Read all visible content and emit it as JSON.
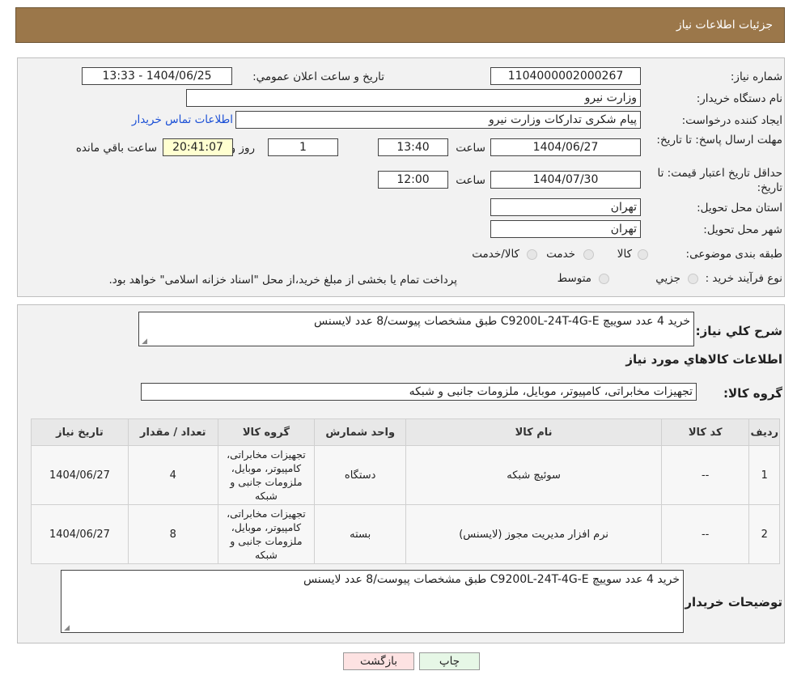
{
  "header": {
    "title": "جزئیات اطلاعات نیاز"
  },
  "info": {
    "need_number_label": "شماره نیاز:",
    "need_number": "1104000002000267",
    "announce_label": "تاریخ و ساعت اعلان عمومي:",
    "announce_value": "1404/06/25 - 13:33",
    "buyer_org_label": "نام دستگاه خريدار:",
    "buyer_org": "وزارت نيرو",
    "creator_label": "ايجاد كننده درخواست:",
    "creator": "پيام شكری تداركات وزارت نيرو",
    "contact_link": "اطلاعات تماس خريدار",
    "deadline_label": "مهلت ارسال پاسخ: تا تاریخ:",
    "deadline_date": "1404/06/27",
    "time_label": "ساعت",
    "deadline_time": "13:40",
    "days": "1",
    "days_label": "روز و",
    "remaining_time": "20:41:07",
    "remaining_label": "ساعت باقي مانده",
    "validity_label": "حداقل تاريخ اعتبار قيمت: تا تاریخ:",
    "validity_date": "1404/07/30",
    "validity_time": "12:00",
    "province_label": "استان محل تحويل:",
    "province": "تهران",
    "city_label": "شهر محل تحويل:",
    "city": "تهران",
    "category_label": "طبقه بندی موضوعی:",
    "category_options": [
      "كالا",
      "خدمت",
      "كالا/خدمت"
    ],
    "process_label": "نوع فرآيند خريد :",
    "process_options": [
      "جزيي",
      "متوسط"
    ],
    "process_note": "پرداخت تمام يا بخشی از مبلغ خريد،از محل \"اسناد خزانه اسلامی\" خواهد بود."
  },
  "details": {
    "summary_label": "شرح كلي نياز:",
    "summary": "خرید 4 عدد سوییچ C9200L-24T-4G-E طبق مشخصات پیوست/8 عدد لایسنس",
    "goods_info_title": "اطلاعات كالاهاي مورد نياز",
    "goods_group_label": "گروه كالا:",
    "goods_group": "تجهيزات مخابراتی، كامپيوتر، موبايل، ملزومات جانبی و شبكه",
    "table": {
      "headers": [
        "رديف",
        "كد كالا",
        "نام كالا",
        "واحد شمارش",
        "گروه كالا",
        "تعداد / مقدار",
        "تاريخ نياز"
      ],
      "rows": [
        {
          "row": "1",
          "code": "--",
          "name": "سوئيچ شبكه",
          "unit": "دستگاه",
          "group": "تجهيزات مخابراتی، كامپيوتر، موبايل، ملزومات جانبی و شبكه",
          "qty": "4",
          "date": "1404/06/27"
        },
        {
          "row": "2",
          "code": "--",
          "name": "نرم افزار مديريت مجوز (لايسنس)",
          "unit": "بسته",
          "group": "تجهيزات مخابراتی، كامپيوتر، موبايل، ملزومات جانبی و شبكه",
          "qty": "8",
          "date": "1404/06/27"
        }
      ]
    },
    "buyer_notes_label": "توضيحات خريدار:",
    "buyer_notes": "خرید 4 عدد سوییچ C9200L-24T-4G-E طبق مشخصات پیوست/8 عدد لایسنس"
  },
  "buttons": {
    "print": "چاپ",
    "back": "بازگشت"
  },
  "colors": {
    "header": "#9b774a",
    "back_button": "#fde2e2",
    "print_button": "#e6f7e6"
  }
}
